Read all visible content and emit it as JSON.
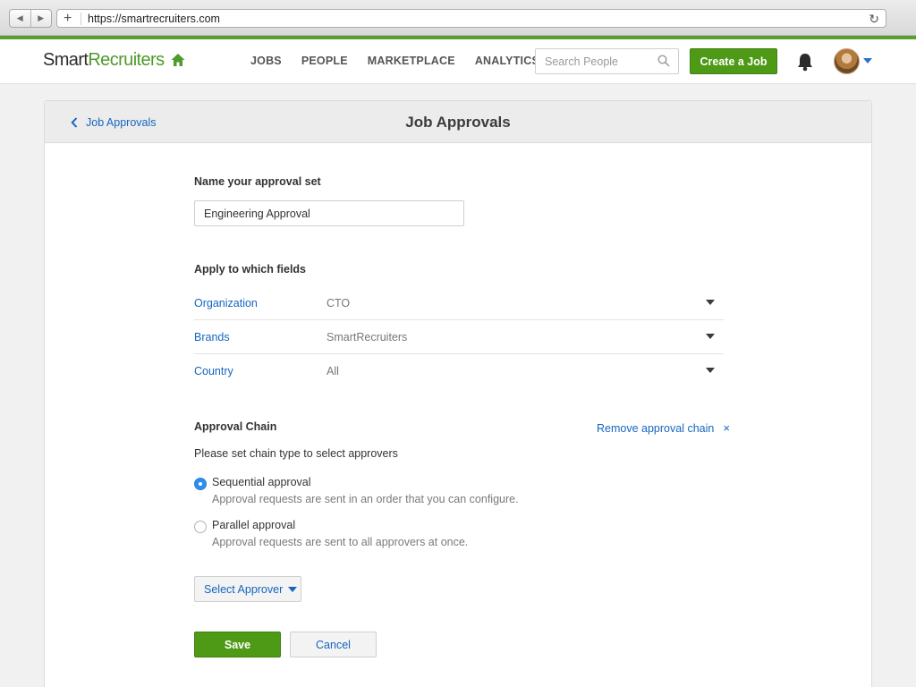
{
  "browser": {
    "url": "https://smartrecruiters.com",
    "new_tab_glyph": "+",
    "reload_icon": "reload-icon"
  },
  "header": {
    "logo_part1": "Smart",
    "logo_part2": "Recruiters",
    "home_icon": "home-icon",
    "nav": [
      {
        "label": "JOBS"
      },
      {
        "label": "PEOPLE"
      },
      {
        "label": "MARKETPLACE"
      },
      {
        "label": "ANALYTICS"
      }
    ],
    "search_placeholder": "Search People",
    "create_job_label": "Create a Job",
    "accent_color": "#4e9a16"
  },
  "page": {
    "back_label": "Job Approvals",
    "title": "Job Approvals"
  },
  "form": {
    "name_label": "Name your approval set",
    "name_value": "Engineering Approval",
    "fields_label": "Apply to which fields",
    "fields": [
      {
        "name": "Organization",
        "value": "CTO"
      },
      {
        "name": "Brands",
        "value": "SmartRecruiters"
      },
      {
        "name": "Country",
        "value": "All"
      }
    ],
    "chain_label": "Approval Chain",
    "remove_chain_label": "Remove approval chain",
    "remove_glyph": "×",
    "chain_hint": "Please set chain type to select approvers",
    "options": [
      {
        "label": "Sequential approval",
        "desc": "Approval requests are sent in an order that you can configure.",
        "selected": true
      },
      {
        "label": "Parallel approval",
        "desc": "Approval requests are sent to all approvers at once.",
        "selected": false
      }
    ],
    "select_approver_label": "Select Approver",
    "save_label": "Save",
    "cancel_label": "Cancel"
  }
}
